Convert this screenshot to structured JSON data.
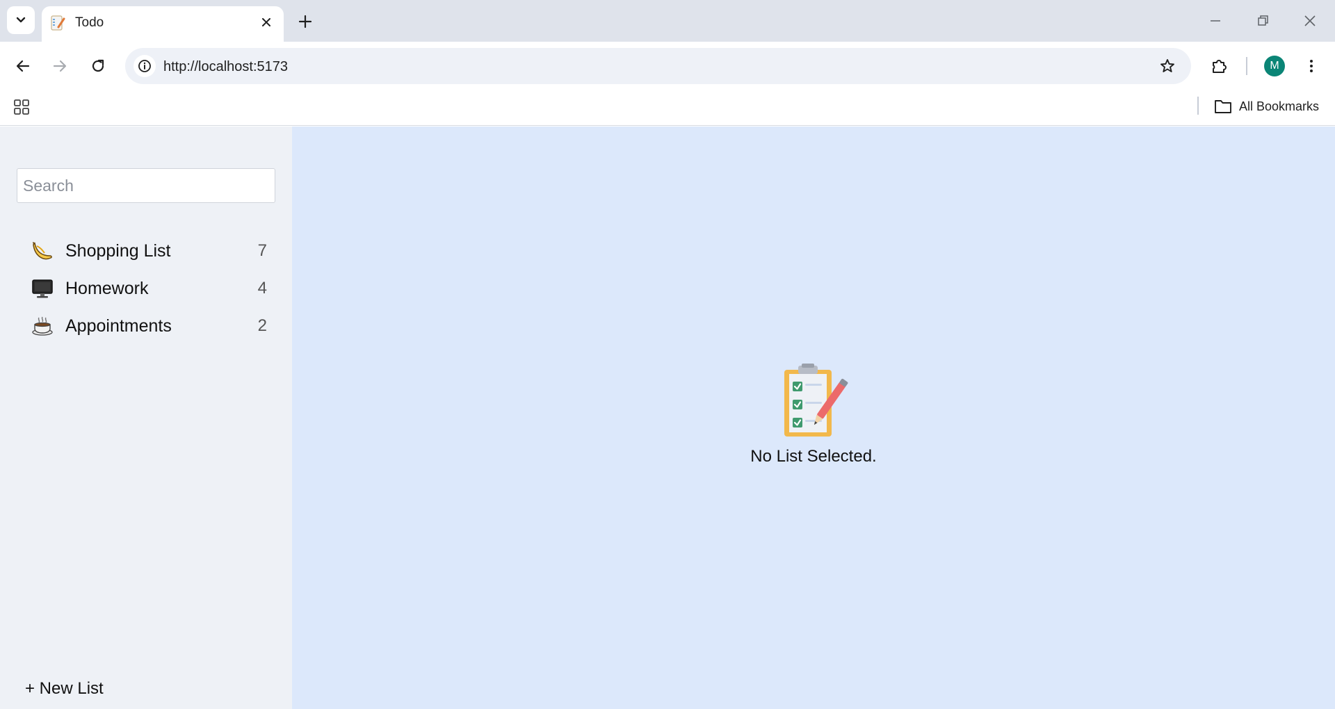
{
  "browser": {
    "tab_title": "Todo",
    "url": "http://localhost:5173",
    "profile_initial": "M",
    "all_bookmarks_label": "All Bookmarks",
    "avatar_color": "#0b8576"
  },
  "sidebar": {
    "search_placeholder": "Search",
    "lists": [
      {
        "emoji": "banana",
        "name": "Shopping List",
        "count": "7"
      },
      {
        "emoji": "desktop-computer",
        "name": "Homework",
        "count": "4"
      },
      {
        "emoji": "hot-beverage",
        "name": "Appointments",
        "count": "2"
      }
    ],
    "new_list_label": "+ New List"
  },
  "main": {
    "empty_icon": "clipboard-checklist-pencil",
    "empty_message": "No List Selected."
  },
  "colors": {
    "sidebar_bg": "#eef1f6",
    "main_bg": "#dce8fb"
  }
}
